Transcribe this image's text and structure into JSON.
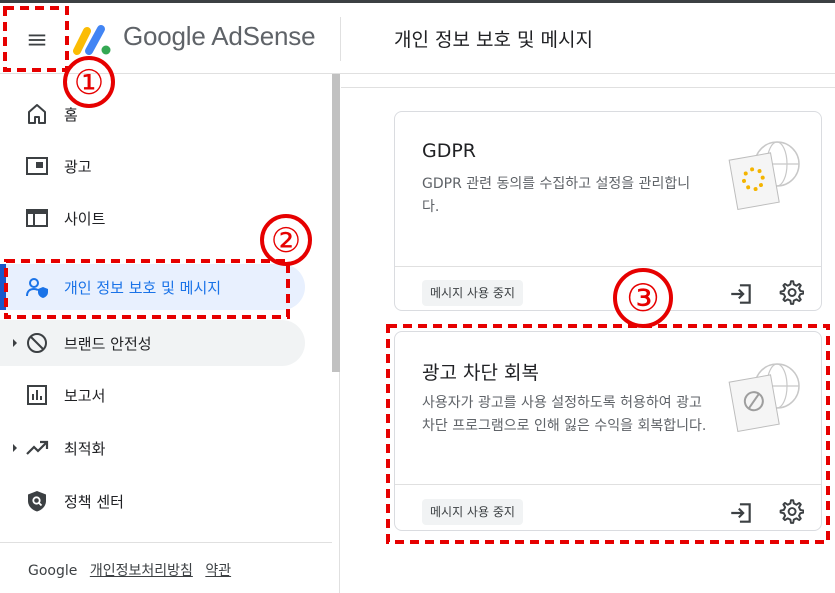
{
  "header": {
    "logo_text": "Google AdSense",
    "page_title": "개인 정보 보호 및 메시지"
  },
  "sidebar": {
    "items": [
      {
        "label": "홈",
        "icon": "home-icon"
      },
      {
        "label": "광고",
        "icon": "ads-icon"
      },
      {
        "label": "사이트",
        "icon": "sites-icon"
      },
      {
        "label": "개인 정보 보호 및 메시지",
        "icon": "privacy-icon",
        "active": true
      },
      {
        "label": "브랜드 안전성",
        "icon": "block-icon",
        "expandable": true
      },
      {
        "label": "보고서",
        "icon": "reports-icon"
      },
      {
        "label": "최적화",
        "icon": "optimization-icon",
        "expandable": true
      },
      {
        "label": "정책 센터",
        "icon": "policy-icon"
      }
    ],
    "footer": {
      "brand": "Google",
      "privacy": "개인정보처리방침",
      "terms": "약관"
    }
  },
  "cards": [
    {
      "title": "GDPR",
      "description": "GDPR 관련 동의를 수집하고 설정을 관리합니다.",
      "chip": "메시지 사용 중지"
    },
    {
      "title": "광고 차단 회복",
      "description": "사용자가 광고를 사용 설정하도록 허용하여 광고 차단 프로그램으로 인해 잃은 수익을 회복합니다.",
      "chip": "메시지 사용 중지"
    }
  ],
  "annotations": [
    "①",
    "②",
    "③"
  ],
  "colors": {
    "accent": "#1a73e8",
    "active_bg": "#e8f0fe",
    "annotation": "#e60000"
  }
}
